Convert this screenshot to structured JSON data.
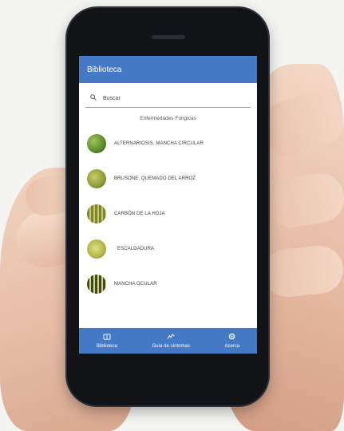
{
  "app": {
    "title": "Biblioteca"
  },
  "search": {
    "placeholder": "Buscar"
  },
  "section_title": "Enfermedades Fúngicas",
  "items": [
    {
      "label": "ALTERNARIOSIS, MANCHA CIRCULAR",
      "icon": "leaf-disease-thumbnail-icon",
      "color": "#5d8a2c"
    },
    {
      "label": "BRUSONE, QUEMADO DEL ARROZ",
      "icon": "leaf-disease-thumbnail-icon",
      "color": "#8d9b36"
    },
    {
      "label": "CARBÓN DE LA HOJA",
      "icon": "leaf-disease-thumbnail-icon",
      "color": "#7c8731"
    },
    {
      "label": "ESCALDADURA",
      "icon": "leaf-disease-thumbnail-icon",
      "color": "#b2b546"
    },
    {
      "label": "MANCHA OCULAR",
      "icon": "leaf-disease-thumbnail-icon",
      "color": "#3e4b21"
    }
  ],
  "nav": [
    {
      "label": "Biblioteca",
      "icon": "book-icon"
    },
    {
      "label": "Guía de síntomas",
      "icon": "symptom-guide-icon"
    },
    {
      "label": "Acerca",
      "icon": "gear-icon"
    }
  ],
  "colors": {
    "primary": "#4479c6"
  }
}
